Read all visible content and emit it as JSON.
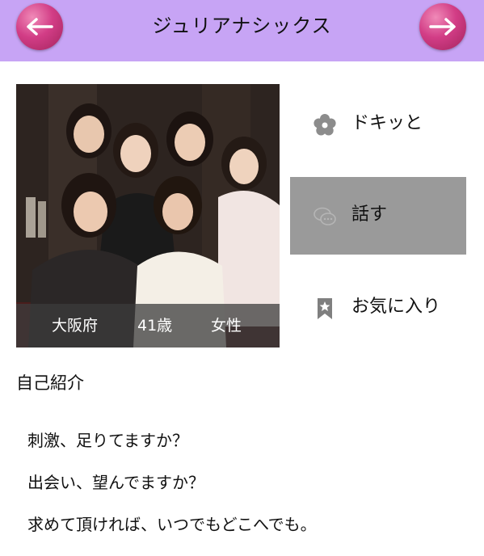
{
  "header": {
    "title": "ジュリアナシックス",
    "back_icon": "arrow-left-icon",
    "next_icon": "arrow-right-icon",
    "bar_color": "#c7a4f5",
    "button_color": "#d23d86"
  },
  "profile": {
    "prefecture": "大阪府",
    "age": "41歳",
    "gender": "女性"
  },
  "actions": [
    {
      "label": "ドキッと",
      "icon": "flower-icon"
    },
    {
      "label": "話す",
      "icon": "chat-bubbles-icon",
      "highlight_color": "#9a9a9a"
    },
    {
      "label": "お気に入り",
      "icon": "bookmark-star-icon"
    }
  ],
  "intro": {
    "heading": "自己紹介",
    "lines": [
      "刺激、足りてますか？",
      "出会い、望んでますか？",
      "求めて頂ければ、いつでもどこへでも。"
    ]
  }
}
